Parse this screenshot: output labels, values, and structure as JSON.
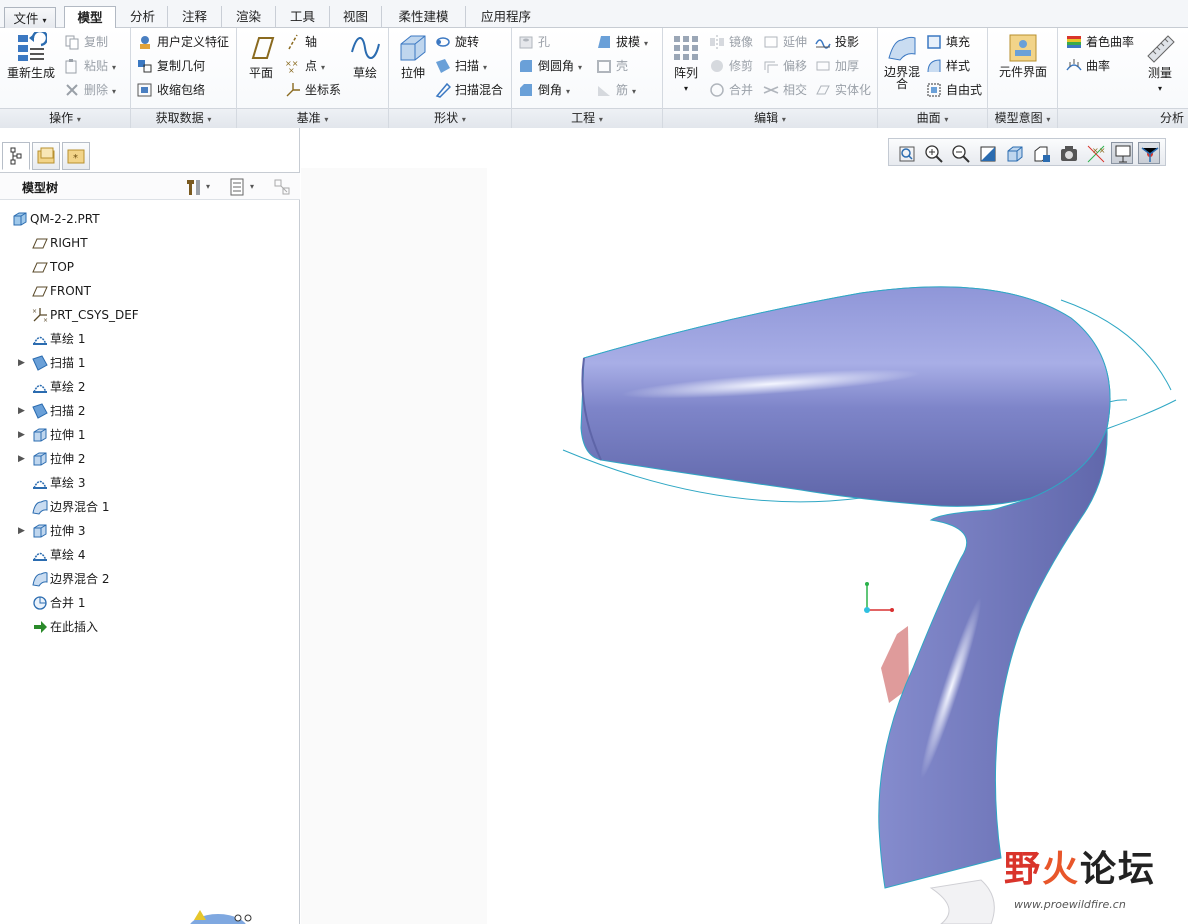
{
  "menu": {
    "tabs": [
      {
        "label": "文件",
        "dropdown": "▾"
      },
      {
        "label": "模型"
      },
      {
        "label": "分析"
      },
      {
        "label": "注释"
      },
      {
        "label": "渲染"
      },
      {
        "label": "工具"
      },
      {
        "label": "视图"
      },
      {
        "label": "柔性建模"
      },
      {
        "label": "应用程序"
      }
    ],
    "active": "模型"
  },
  "ribbon": {
    "groups": {
      "operations": {
        "label": "操作",
        "regen": "重新生成",
        "copy": "复制",
        "paste": "粘贴",
        "delete": "删除"
      },
      "get_data": {
        "label": "获取数据",
        "udf": "用户定义特征",
        "copy_geom": "复制几何",
        "shrinkwrap": "收缩包络"
      },
      "datum": {
        "label": "基准",
        "plane": "平面",
        "axis": "轴",
        "point": "点",
        "csys": "坐标系",
        "sketch": "草绘"
      },
      "shapes": {
        "label": "形状",
        "extrude": "拉伸",
        "revolve": "旋转",
        "sweep": "扫描",
        "swept_blend": "扫描混合"
      },
      "engineering": {
        "label": "工程",
        "hole": "孔",
        "round": "倒圆角",
        "chamfer": "倒角",
        "draft": "拔模",
        "shell": "壳",
        "rib": "筋"
      },
      "editing": {
        "label": "编辑",
        "pattern": "阵列",
        "mirror": "镜像",
        "trim": "修剪",
        "merge": "合并",
        "extend": "延伸",
        "offset": "偏移",
        "intersect": "相交",
        "project": "投影",
        "thicken": "加厚",
        "solidify": "实体化"
      },
      "surfaces": {
        "label": "曲面",
        "boundary_blend": "边界混合",
        "fill": "填充",
        "style": "样式",
        "freestyle": "自由式"
      },
      "model_intent": {
        "label": "模型意图",
        "component_interface": "元件界面"
      },
      "analysis": {
        "label": "分析",
        "shaded_curvature": "着色曲率",
        "curvature": "曲率",
        "measure": "测量"
      }
    }
  },
  "model_tree": {
    "title": "模型树",
    "nodes": [
      {
        "label": "QM-2-2.PRT",
        "icon": "part-icon",
        "expandable": false
      },
      {
        "label": "RIGHT",
        "icon": "datum-plane-icon",
        "expandable": false
      },
      {
        "label": "TOP",
        "icon": "datum-plane-icon",
        "expandable": false
      },
      {
        "label": "FRONT",
        "icon": "datum-plane-icon",
        "expandable": false
      },
      {
        "label": "PRT_CSYS_DEF",
        "icon": "csys-icon",
        "expandable": false
      },
      {
        "label": "草绘 1",
        "icon": "sketch-icon",
        "expandable": false
      },
      {
        "label": "扫描 1",
        "icon": "sweep-icon",
        "expandable": true
      },
      {
        "label": "草绘 2",
        "icon": "sketch-icon",
        "expandable": false
      },
      {
        "label": "扫描 2",
        "icon": "sweep-icon",
        "expandable": true
      },
      {
        "label": "拉伸 1",
        "icon": "extrude-icon",
        "expandable": true
      },
      {
        "label": "拉伸 2",
        "icon": "extrude-icon",
        "expandable": true
      },
      {
        "label": "草绘 3",
        "icon": "sketch-icon",
        "expandable": false
      },
      {
        "label": "边界混合 1",
        "icon": "boundary-blend-icon",
        "expandable": false
      },
      {
        "label": "拉伸 3",
        "icon": "extrude-icon",
        "expandable": true
      },
      {
        "label": "草绘 4",
        "icon": "sketch-icon",
        "expandable": false
      },
      {
        "label": "边界混合 2",
        "icon": "boundary-blend-icon",
        "expandable": false
      },
      {
        "label": "合并 1",
        "icon": "merge-icon",
        "expandable": false
      },
      {
        "label": "在此插入",
        "icon": "insert-here-arrow-icon",
        "expandable": false
      }
    ]
  },
  "view_toolbar": {
    "buttons": [
      "refit-icon",
      "zoom-in-icon",
      "zoom-out-icon",
      "repaint-icon",
      "display-style-icon",
      "saved-orientations-icon",
      "view-manager-icon",
      "perspective-icon",
      "datum-display-icon",
      "spin-center-icon",
      "annotation-display-icon"
    ]
  },
  "watermark": {
    "text_cn": "野火论坛",
    "url": "www.proewildfire.cn"
  },
  "colors": {
    "model_surface": "#7b82c9",
    "model_highlight": "#e9ecff",
    "edge_line": "#2fa7c4",
    "ribbon_accent": "#2b6cb0",
    "watermark_red": "#d9342b"
  }
}
